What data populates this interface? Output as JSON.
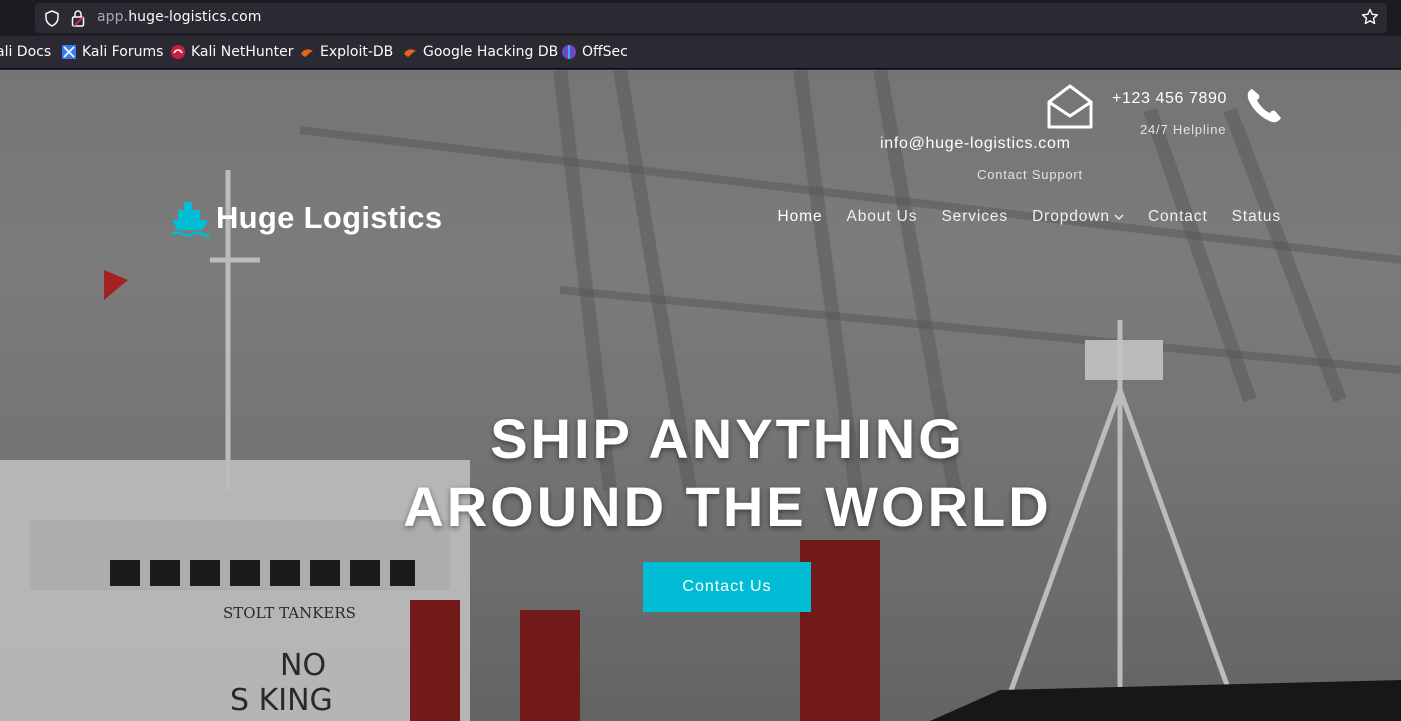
{
  "browser": {
    "url_prefix": "app.",
    "url_domain": "huge-logistics.com",
    "bookmarks": [
      {
        "label": "ali Docs",
        "icon": "kali-docs-icon"
      },
      {
        "label": "Kali Forums",
        "icon": "kali-forums-icon"
      },
      {
        "label": "Kali NetHunter",
        "icon": "kali-nethunter-icon"
      },
      {
        "label": "Exploit-DB",
        "icon": "exploit-db-icon"
      },
      {
        "label": "Google Hacking DB",
        "icon": "ghdb-icon"
      },
      {
        "label": "OffSec",
        "icon": "offsec-icon"
      }
    ]
  },
  "header": {
    "phone": "+123 456 7890",
    "phone_sub": "24/7 Helpline",
    "email": "info@huge-logistics.com",
    "email_sub": "Contact Support"
  },
  "brand": {
    "name": "Huge Logistics",
    "accent": "#00bcd4"
  },
  "nav": {
    "items": [
      "Home",
      "About Us",
      "Services",
      "Dropdown",
      "Contact",
      "Status"
    ]
  },
  "hero": {
    "line1": "SHIP ANYTHING",
    "line2": "AROUND THE WORLD",
    "cta": "Contact Us"
  }
}
